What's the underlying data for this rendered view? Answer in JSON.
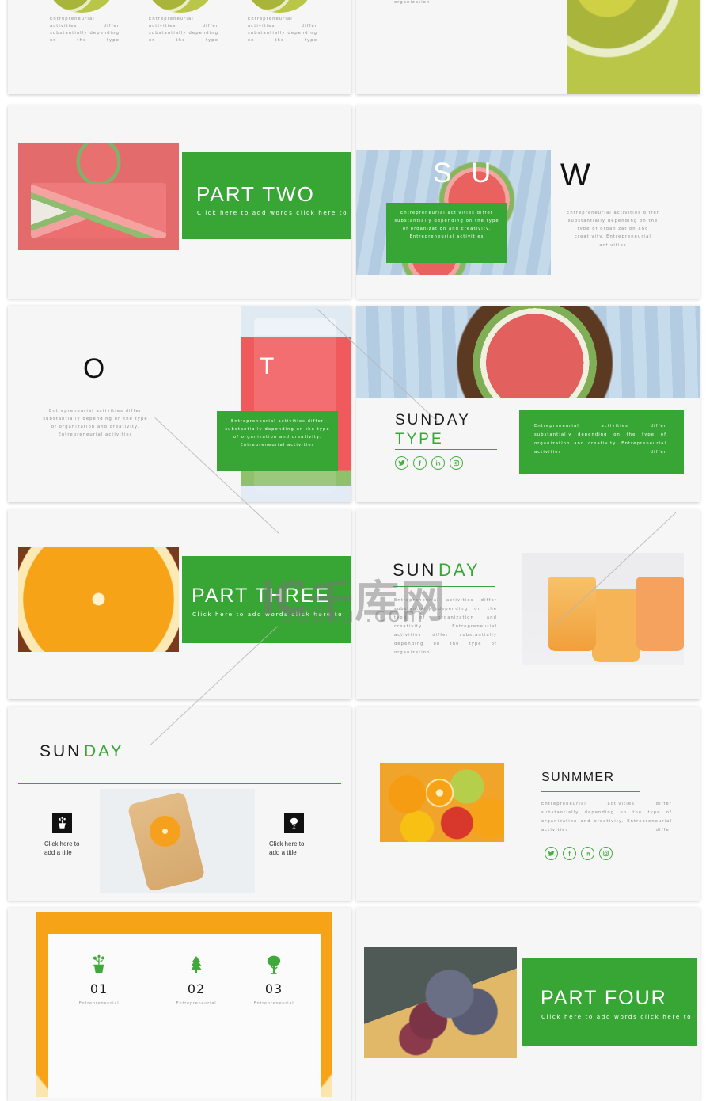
{
  "meta": {
    "accent_green": "#37a635",
    "body_text_color": "#8d8d8d",
    "card_bg": "#f6f6f6",
    "page_bg": "#ffffff"
  },
  "watermark": {
    "logo": "IC",
    "brand_cn": "千库网",
    "url": "588ku .com"
  },
  "paragraphs": {
    "short": "Entrepreneurial activities differ substantially depending on the type",
    "short_alt": "Entrepreneurial activities differ substantially depending on the type",
    "medium": "Entrepreneurial activities differ substantially depending on the type of organization and creativity. Entrepreneurial activities",
    "long": "Entrepreneurial activities differ substantially depending on the type of organization and creativity. Entrepreneurial activities differ substantially depending on the type of organization",
    "block": "Entrepreneurial activities differ substantially depending on the type of organization and creativity. Entrepreneurial activities differ",
    "tiny": "Entrepreneurial"
  },
  "slides": [
    {
      "id": "slide-1",
      "name": "three-column-kiwi",
      "columns": [
        {
          "text": "Entrepreneurial activities differ substantially depending on the type"
        },
        {
          "text": "Entrepreneurial activities differ substantially depending on the type"
        },
        {
          "text": "Entrepreneurial activities differ substantially depending on the type"
        }
      ]
    },
    {
      "id": "slide-2",
      "name": "kiwi-text-right-image",
      "text": "Entrepreneurial activities differ substantially depending on the type of organization and creativity. Entrepreneurial activities differ substantially depending on the type of organization",
      "image": "kiwi-slices"
    },
    {
      "id": "slide-3",
      "name": "part-two",
      "title": "PART TWO",
      "subtitle": "Click here to add words click here to",
      "image": "watermelon-tray"
    },
    {
      "id": "slide-4",
      "name": "sun-w-split",
      "letter_left": "S",
      "letter_left_2": "U",
      "letter_right": "W",
      "green_text": "Entrepreneurial activities differ substantially depending on the type of organization and creativity. Entrepreneurial activities",
      "right_text": "Entrepreneurial activities differ substantially depending on the type of organization and creativity. Entrepreneurial activities",
      "image": "watermelon-blue-board"
    },
    {
      "id": "slide-5",
      "name": "o-t-split",
      "letter_left": "O",
      "letter_right": "T",
      "left_text": "Entrepreneurial activities differ substantially depending on the type of organization and creativity. Entrepreneurial activities",
      "green_text": "Entrepreneurial activities differ substantially depending on the type of organization and creativity. Entrepreneurial activities",
      "image": "watermelon-juice-jar"
    },
    {
      "id": "slide-6",
      "name": "sunday-type",
      "title_line1": "SUNDAY",
      "title_line2": "TYPE",
      "green_text": "Entrepreneurial activities differ substantially depending on the type of organization and creativity. Entrepreneurial activities differ",
      "social": [
        "twitter",
        "facebook",
        "linkedin",
        "instagram"
      ],
      "image": "watermelon-bowl"
    },
    {
      "id": "slide-7",
      "name": "part-three",
      "title": "PART THREE",
      "subtitle": "Click here to add words click here to",
      "image": "orange-slice"
    },
    {
      "id": "slide-8",
      "name": "sunday-text-image",
      "title_dark": "SUN",
      "title_green": "DAY",
      "text": "Entrepreneurial activities differ substantially depending on the type of organization and creativity. Entrepreneurial activities differ substantially depending on the type of organization",
      "image": "citrus-jars"
    },
    {
      "id": "slide-9",
      "name": "sunday-two-features",
      "title_dark": "SUN",
      "title_green": "DAY",
      "features": [
        {
          "icon": "potted-plant-icon",
          "label": "Click here to\nadd a title"
        },
        {
          "icon": "tree-icon",
          "label": "Click here to\nadd a title"
        }
      ],
      "image": "orange-cutting-board"
    },
    {
      "id": "slide-10",
      "name": "sunmmer",
      "title": "SUNMMER",
      "text": "Entrepreneurial activities differ substantially depending on the type of organization and creativity. Entrepreneurial activities differ",
      "social": [
        "twitter",
        "facebook",
        "linkedin",
        "instagram"
      ],
      "image": "mixed-fruits"
    },
    {
      "id": "slide-11",
      "name": "three-numbers",
      "items": [
        {
          "icon": "potted-flower-icon",
          "number": "01",
          "text": "Entrepreneurial"
        },
        {
          "icon": "pine-tree-icon",
          "number": "02",
          "text": "Entrepreneurial"
        },
        {
          "icon": "round-tree-icon",
          "number": "03",
          "text": "Entrepreneurial"
        }
      ],
      "image": "orange-texture"
    },
    {
      "id": "slide-12",
      "name": "part-four",
      "title": "PART FOUR",
      "subtitle": "Click here to add words click here to",
      "image": "grapes-plate"
    }
  ]
}
